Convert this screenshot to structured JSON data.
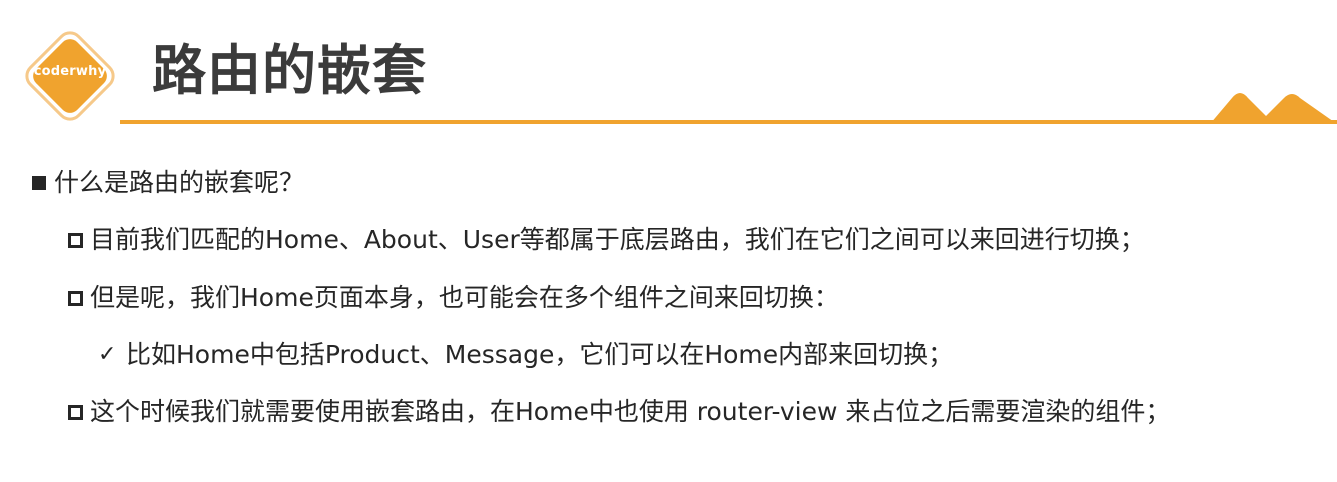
{
  "logo": {
    "text": "coderwhy",
    "color": "#f0a32e"
  },
  "title": "路由的嵌套",
  "accent_color": "#f0a32e",
  "bullets": [
    {
      "level": 1,
      "marker": "filled-square",
      "text": "什么是路由的嵌套呢？"
    },
    {
      "level": 2,
      "marker": "hollow-square",
      "text": "目前我们匹配的Home、About、User等都属于底层路由，我们在它们之间可以来回进行切换；"
    },
    {
      "level": 2,
      "marker": "hollow-square",
      "text": "但是呢，我们Home页面本身，也可能会在多个组件之间来回切换："
    },
    {
      "level": 3,
      "marker": "checkmark",
      "symbol": "✓",
      "text": "比如Home中包括Product、Message，它们可以在Home内部来回切换；"
    },
    {
      "level": 2,
      "marker": "hollow-square",
      "text": "这个时候我们就需要使用嵌套路由，在Home中也使用 router-view 来占位之后需要渲染的组件；"
    }
  ]
}
